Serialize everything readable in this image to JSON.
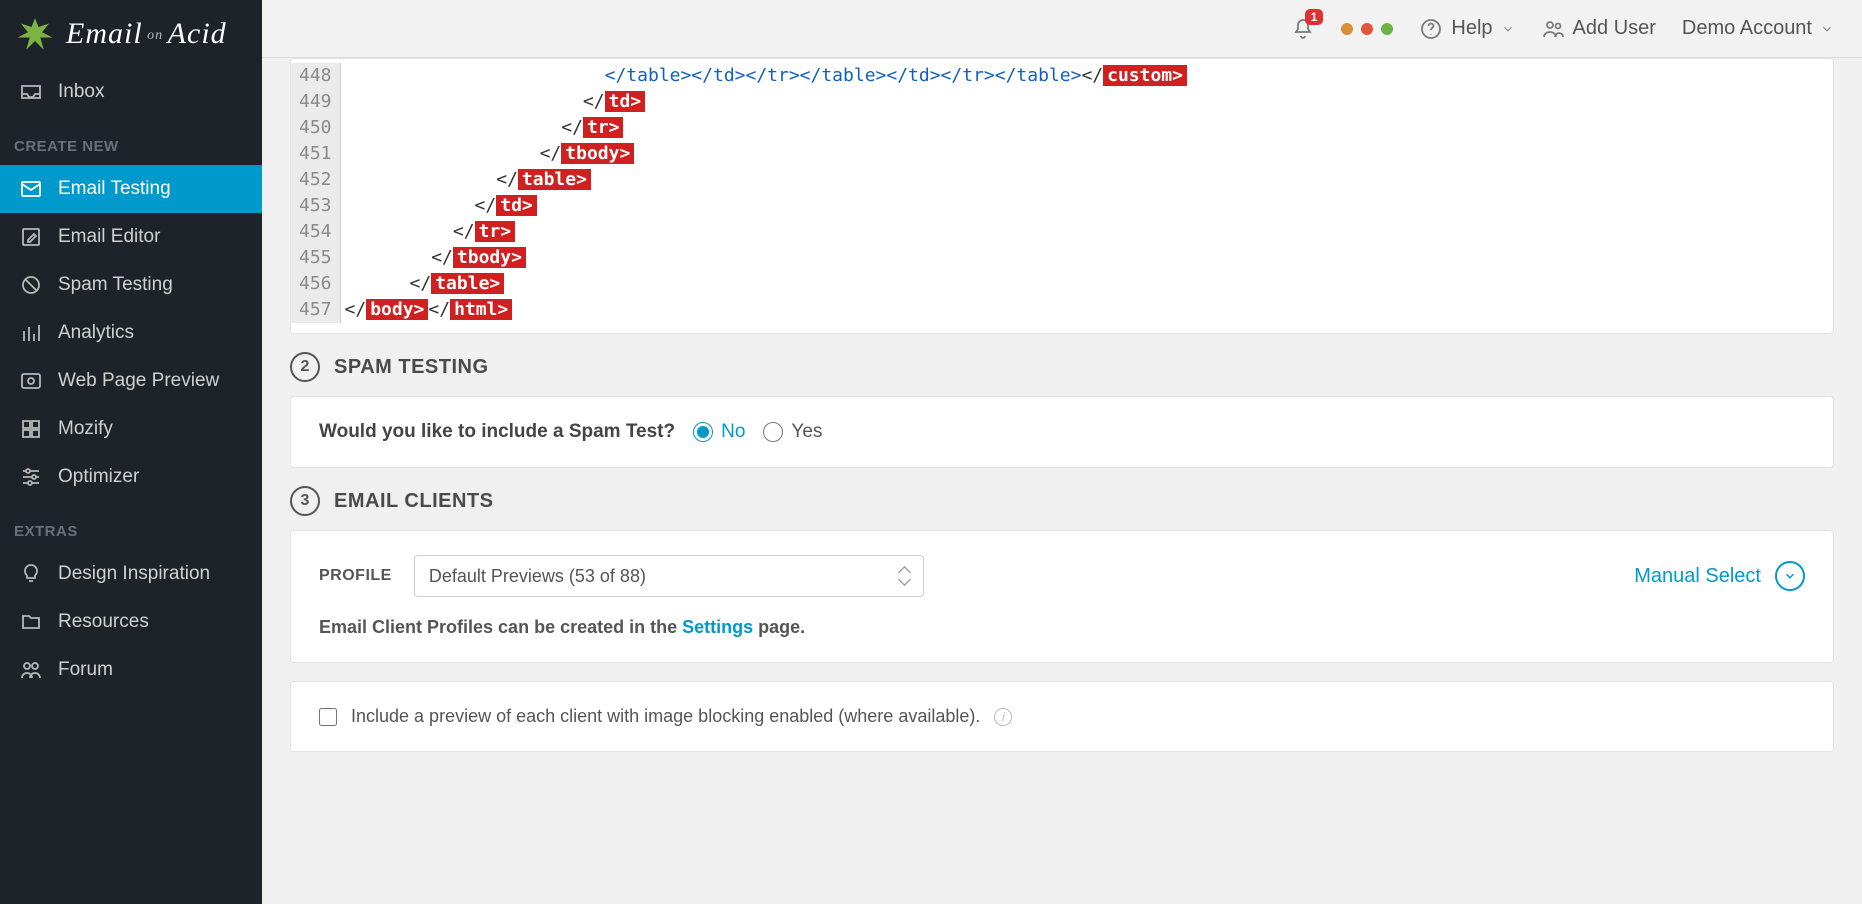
{
  "brand": {
    "name": "Email on Acid"
  },
  "topbar": {
    "notifications": {
      "count": "1"
    },
    "help": "Help",
    "addUser": "Add User",
    "account": "Demo Account",
    "dotColors": [
      "#d98f3a",
      "#e0563c",
      "#6bb546"
    ]
  },
  "sidebar": {
    "inbox": "Inbox",
    "sectionCreate": "CREATE NEW",
    "createItems": [
      {
        "id": "email-testing",
        "label": "Email Testing",
        "active": true
      },
      {
        "id": "email-editor",
        "label": "Email Editor",
        "active": false
      },
      {
        "id": "spam-testing",
        "label": "Spam Testing",
        "active": false
      },
      {
        "id": "analytics",
        "label": "Analytics",
        "active": false
      },
      {
        "id": "web-page-preview",
        "label": "Web Page Preview",
        "active": false
      },
      {
        "id": "mozify",
        "label": "Mozify",
        "active": false
      },
      {
        "id": "optimizer",
        "label": "Optimizer",
        "active": false
      }
    ],
    "sectionExtras": "EXTRAS",
    "extraItems": [
      {
        "id": "design-inspiration",
        "label": "Design Inspiration"
      },
      {
        "id": "resources",
        "label": "Resources"
      },
      {
        "id": "forum",
        "label": "Forum"
      }
    ]
  },
  "code": {
    "startLine": 448,
    "lines": [
      {
        "indent": 24,
        "segs": [
          {
            "t": "blue",
            "txt": "</table></td></tr></table></td></tr></table>"
          },
          {
            "t": "plain",
            "txt": "</"
          },
          {
            "t": "err",
            "txt": "custom>"
          }
        ]
      },
      {
        "indent": 22,
        "segs": [
          {
            "t": "plain",
            "txt": "</"
          },
          {
            "t": "err",
            "txt": "td>"
          }
        ]
      },
      {
        "indent": 20,
        "segs": [
          {
            "t": "plain",
            "txt": "</"
          },
          {
            "t": "err",
            "txt": "tr>"
          }
        ]
      },
      {
        "indent": 18,
        "segs": [
          {
            "t": "plain",
            "txt": "</"
          },
          {
            "t": "err",
            "txt": "tbody>"
          }
        ]
      },
      {
        "indent": 14,
        "segs": [
          {
            "t": "plain",
            "txt": "</"
          },
          {
            "t": "err",
            "txt": "table>"
          }
        ]
      },
      {
        "indent": 12,
        "segs": [
          {
            "t": "plain",
            "txt": "</"
          },
          {
            "t": "err",
            "txt": "td>"
          }
        ]
      },
      {
        "indent": 10,
        "segs": [
          {
            "t": "plain",
            "txt": "</"
          },
          {
            "t": "err",
            "txt": "tr>"
          }
        ]
      },
      {
        "indent": 8,
        "segs": [
          {
            "t": "plain",
            "txt": "</"
          },
          {
            "t": "err",
            "txt": "tbody>"
          }
        ]
      },
      {
        "indent": 6,
        "segs": [
          {
            "t": "plain",
            "txt": "</"
          },
          {
            "t": "err",
            "txt": "table>"
          }
        ]
      },
      {
        "indent": 0,
        "segs": [
          {
            "t": "plain",
            "txt": "</"
          },
          {
            "t": "err",
            "txt": "body>"
          },
          {
            "t": "plain",
            "txt": "</"
          },
          {
            "t": "err",
            "txt": "html>"
          }
        ]
      }
    ]
  },
  "step2": {
    "number": "2",
    "title": "SPAM TESTING",
    "question": "Would you like to include a Spam Test?",
    "optNo": "No",
    "optYes": "Yes",
    "selected": "no"
  },
  "step3": {
    "number": "3",
    "title": "EMAIL CLIENTS",
    "profileLabel": "PROFILE",
    "profileValue": "Default Previews (53 of 88)",
    "helperPrefix": "Email Client Profiles can be created in the ",
    "helperLink": "Settings",
    "helperSuffix": " page.",
    "manualSelect": "Manual Select",
    "includePreview": "Include a preview of each client with image blocking enabled (where available)."
  }
}
